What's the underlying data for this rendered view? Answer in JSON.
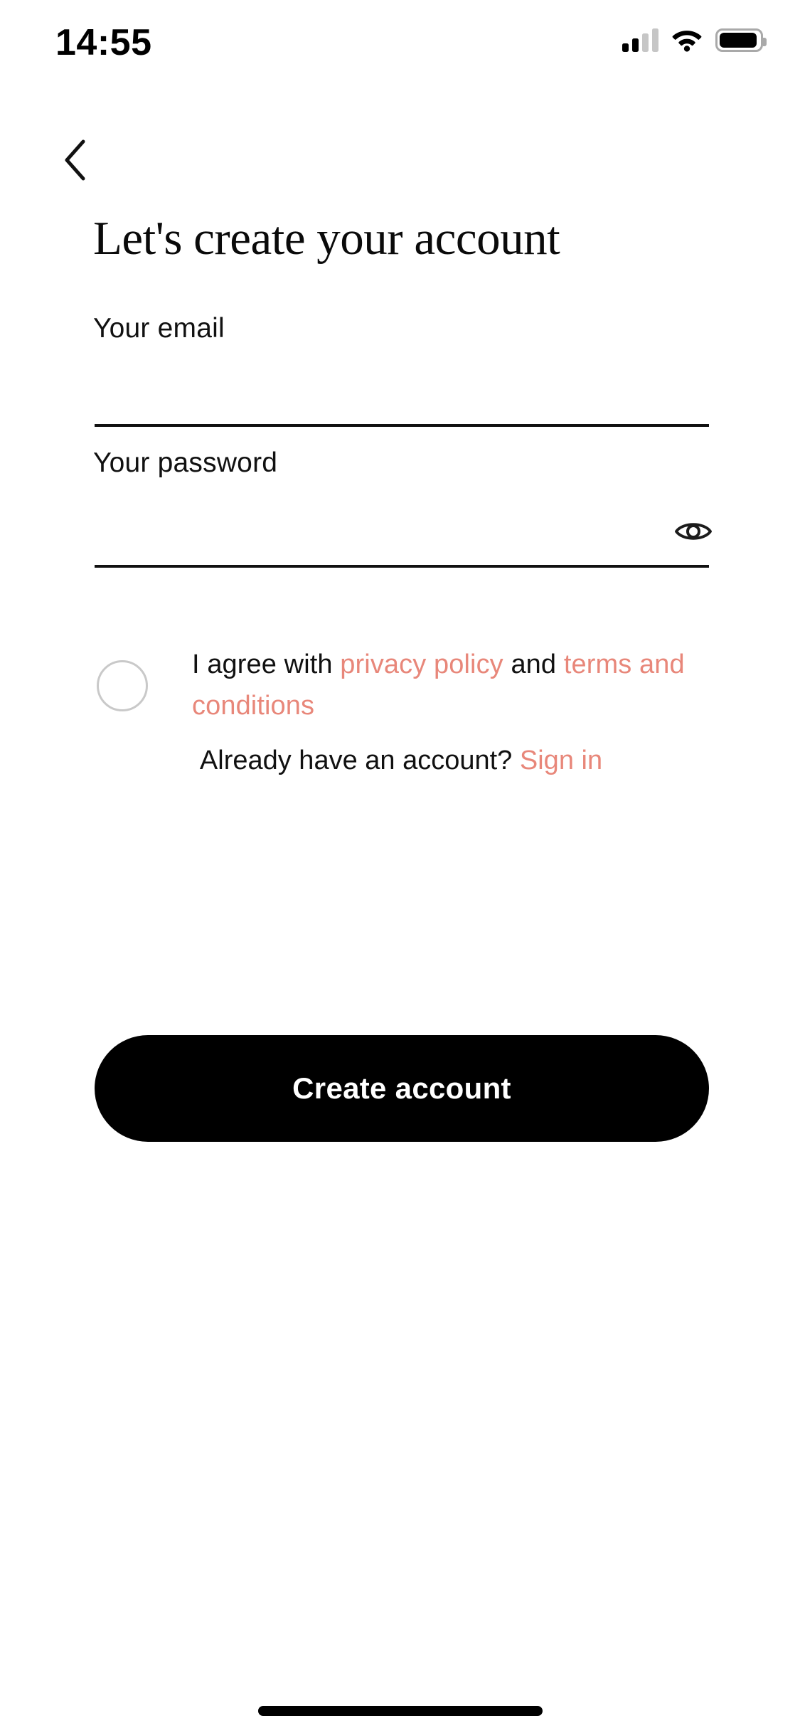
{
  "status_bar": {
    "time": "14:55",
    "cellular_icon": "cellular-signal-icon",
    "cellular_bars_filled": 2,
    "cellular_bars_total": 4,
    "wifi_icon": "wifi-icon",
    "battery_icon": "battery-icon",
    "battery_level_percent": 90
  },
  "nav": {
    "back_icon": "chevron-left-icon"
  },
  "page": {
    "title": "Let's create your account"
  },
  "form": {
    "email": {
      "label": "Your email",
      "value": "",
      "placeholder": ""
    },
    "password": {
      "label": "Your password",
      "value": "",
      "placeholder": "",
      "visibility_icon": "eye-icon",
      "visible": false
    }
  },
  "agreement": {
    "checked": false,
    "prefix": "I agree with ",
    "privacy_link": "privacy policy",
    "conjunction": " and ",
    "terms_link": "terms and conditions"
  },
  "signin": {
    "prompt": "Already have an account? ",
    "link": "Sign in"
  },
  "primary_action": {
    "label": "Create account"
  },
  "colors": {
    "accent": "#e8877a",
    "button_bg": "#000000",
    "button_text": "#ffffff",
    "text": "#111111",
    "checkbox_border": "#c9c9c9",
    "background": "#ffffff"
  }
}
